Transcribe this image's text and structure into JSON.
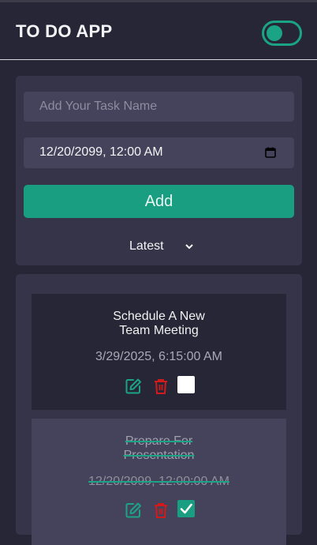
{
  "header": {
    "title": "TO DO APP",
    "theme_toggle": {
      "icon": "toggle-icon",
      "state": "on"
    }
  },
  "form": {
    "task_input": {
      "placeholder": "Add Your Task Name",
      "value": ""
    },
    "date_input": {
      "value": "12/20/2099, 12:00 AM",
      "icon": "calendar-icon"
    },
    "add_label": "Add",
    "sort": {
      "selected": "Latest",
      "icon": "chevron-down-icon"
    }
  },
  "tasks": [
    {
      "name_line1": "Schedule A New",
      "name_line2": "Team Meeting",
      "date": "3/29/2025, 6:15:00 AM",
      "completed": false
    },
    {
      "name_line1": "Prepare For",
      "name_line2": "Presentation",
      "date": "12/20/2099, 12:00:00 AM",
      "completed": true
    }
  ],
  "colors": {
    "background": "#272636",
    "card": "#353449",
    "input": "#45435b",
    "accent": "#1a9e82",
    "delete": "#d11a1a"
  }
}
